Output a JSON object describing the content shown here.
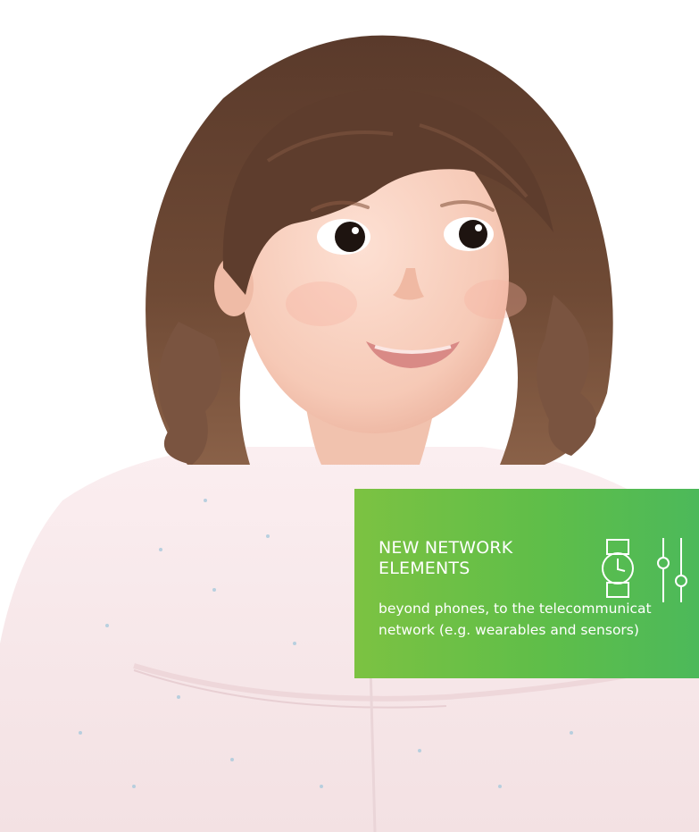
{
  "card": {
    "title_lines": [
      "NEW NETWORK",
      "ELEMENTS"
    ],
    "body_lines": [
      "beyond phones, to the telecommunicat",
      "network (e.g. wearables and sensors)"
    ],
    "icons": [
      "smartwatch-icon",
      "sliders-icon"
    ],
    "gradient": [
      "#7cc242",
      "#4cb95a"
    ],
    "text_color": "#ffffff"
  },
  "photo": {
    "subject": "smiling toddler girl with brown hair in a pink top",
    "background_color": "#ffffff",
    "top_color": "#f7e9ea"
  }
}
